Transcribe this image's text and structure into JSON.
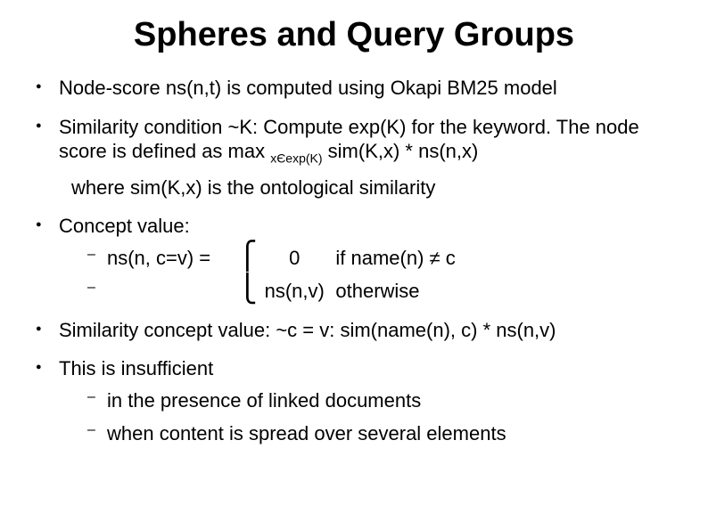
{
  "title": "Spheres and Query Groups",
  "bullets": {
    "b1": "Node-score ns(n,t) is computed using Okapi BM25 model",
    "b2": {
      "part1": "Similarity condition ~K: Compute exp(K) for the keyword. The node score is defined as max ",
      "sub": "xЄexp(K)",
      "part2": " sim(K,x) * ns(n,x)",
      "where": "where sim(K,x) is the ontological similarity"
    },
    "b3": {
      "label": "Concept value:",
      "case": {
        "lhs": "ns(n, c=v) =",
        "braceTop": "⎧",
        "braceBottom": "⎩",
        "val1": "0",
        "cond1": "if name(n) ≠ c",
        "val2": "ns(n,v)",
        "cond2": "   otherwise"
      }
    },
    "b4": "Similarity concept value: ~c = v: sim(name(n), c) * ns(n,v)",
    "b5": {
      "label": "This is insufficient",
      "items": [
        "in the presence of linked documents",
        "when content is spread over several elements"
      ]
    }
  }
}
